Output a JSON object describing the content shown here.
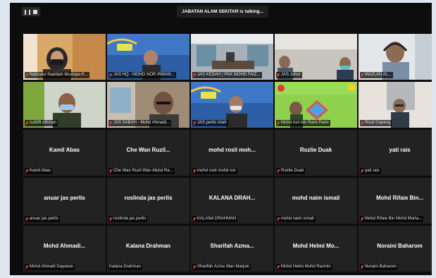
{
  "meeting": {
    "talking_banner": "JABATAN ALAM SEKITAR is talking..."
  },
  "icons": {
    "pause": "pause-icon",
    "stop": "stop-icon",
    "muted_mic": "muted-mic-icon"
  },
  "colors": {
    "tile_background": "#222222",
    "screen_background": "#0d0d0d",
    "muted_mic": "#ff3b30",
    "banner_green": "#8fd14f"
  },
  "tiles": [
    {
      "label": "Nadzatul Naddiah Mustapa K...",
      "muted": true,
      "video": true
    },
    {
      "label": "JAS HQ - MOHD NOR IRWAN...",
      "muted": true,
      "video": true
    },
    {
      "label": "JAS KEDAH | PKK MOHD FAIZ...",
      "muted": true,
      "video": true
    },
    {
      "label": "JAS Johor",
      "muted": true,
      "video": true
    },
    {
      "label": "MAZLAN AL...",
      "muted": true,
      "video": true
    },
    {
      "label": "zulkifli othman",
      "muted": true,
      "video": true
    },
    {
      "label": "JAS SABAH - Mohd Ahmadi...",
      "muted": true,
      "video": true
    },
    {
      "label": "JAS perlis shah",
      "muted": true,
      "video": true
    },
    {
      "label": "Mohd Asri bin Rami Rami",
      "muted": true,
      "video": true
    },
    {
      "label": "Rizal Gopeng",
      "muted": true,
      "video": true
    },
    {
      "name": "Kamil Abas",
      "label": "Kamil Abas",
      "muted": true,
      "video": false
    },
    {
      "name": "Che Wan Ruzil...",
      "label": "Che Wan Ruzil Wan Abdul Ra...",
      "muted": true,
      "video": false
    },
    {
      "name": "mohd rosli moh...",
      "label": "mohd rosli mohd nor",
      "muted": true,
      "video": false
    },
    {
      "name": "Rozlie Duak",
      "label": "Rozlie Duak",
      "muted": true,
      "video": false
    },
    {
      "name": "yati rais",
      "label": "yati rais",
      "muted": true,
      "video": false
    },
    {
      "name": "anuar jas perlis",
      "label": "anuar jas perlis",
      "muted": true,
      "video": false
    },
    {
      "name": "roslinda jas perlis",
      "label": "roslinda jas perlis",
      "muted": true,
      "video": false
    },
    {
      "name": "KALANA DRAH...",
      "label": "KALANA DRAHMAN",
      "muted": true,
      "video": false
    },
    {
      "name": "mohd naim ismail",
      "label": "mohd naim ismail",
      "muted": true,
      "video": false
    },
    {
      "name": "Mohd Rifaie Bin...",
      "label": "Mohd Rifaie Bin Mohd Murta...",
      "muted": true,
      "video": false
    },
    {
      "name": "Mohd Ahmadi...",
      "label": "Mohd Ahmadi Dayukan",
      "muted": true,
      "video": false
    },
    {
      "name": "Kalana Drahman",
      "label": "Kalana Drahman",
      "muted": false,
      "video": false
    },
    {
      "name": "Sharifah Azma...",
      "label": "Sharifah Azma Wan Marjuki",
      "muted": true,
      "video": false
    },
    {
      "name": "Mohd Helmi Mo...",
      "label": "Mohd Helmi Mohd Razmin",
      "muted": true,
      "video": false
    },
    {
      "name": "Noraini Baharom",
      "label": "Noraini Baharom",
      "muted": true,
      "video": false
    }
  ]
}
